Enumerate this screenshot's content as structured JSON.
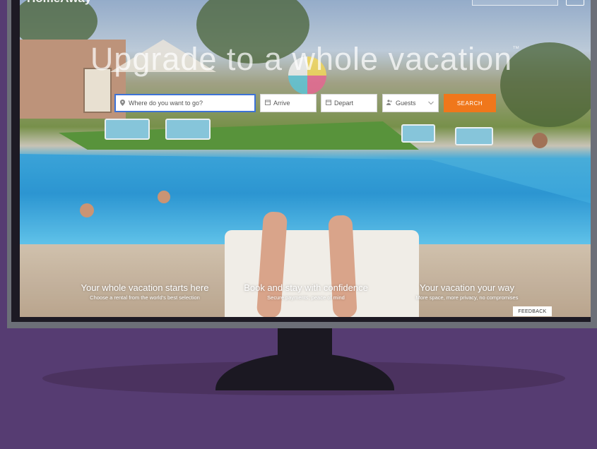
{
  "brand": {
    "name": "HomeAway"
  },
  "hero": {
    "headline": "Upgrade to a whole vacation",
    "trademark": "™"
  },
  "search": {
    "where_placeholder": "Where do you want to go?",
    "arrive_placeholder": "Arrive",
    "depart_placeholder": "Depart",
    "guests_placeholder": "Guests",
    "search_label": "SEARCH",
    "icons": {
      "where": "map-pin-icon",
      "arrive": "calendar-icon",
      "depart": "calendar-icon",
      "guests": "people-icon",
      "caret": "chevron-down-icon"
    }
  },
  "value_props": [
    {
      "title": "Your whole vacation starts here",
      "subtitle": "Choose a rental from the world's best selection"
    },
    {
      "title": "Book and stay with confidence",
      "subtitle": "Secure payments, peace of mind"
    },
    {
      "title": "Your vacation your way",
      "subtitle": "More space, more privacy, no compromises"
    }
  ],
  "feedback_label": "FEEDBACK",
  "colors": {
    "accent": "#f0771b",
    "focus": "#3d72d6",
    "background": "#563c72"
  }
}
